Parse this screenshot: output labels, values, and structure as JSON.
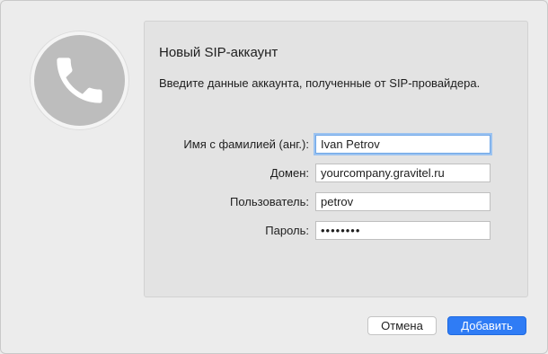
{
  "dialog": {
    "title": "Новый SIP-аккаунт",
    "subtitle": "Введите данные аккаунта, полученные от SIP-провайдера.",
    "icon": "phone-icon"
  },
  "form": {
    "name": {
      "label": "Имя с фамилией (анг.):",
      "value": "Ivan Petrov"
    },
    "domain": {
      "label": "Домен:",
      "value": "yourcompany.gravitel.ru"
    },
    "user": {
      "label": "Пользователь:",
      "value": "petrov"
    },
    "password": {
      "label": "Пароль:",
      "value": "••••••••"
    }
  },
  "buttons": {
    "cancel": "Отмена",
    "add": "Добавить"
  },
  "colors": {
    "accent": "#2f7cf5",
    "panel": "#e3e3e3",
    "background": "#ececec",
    "avatar": "#bdbdbd"
  }
}
